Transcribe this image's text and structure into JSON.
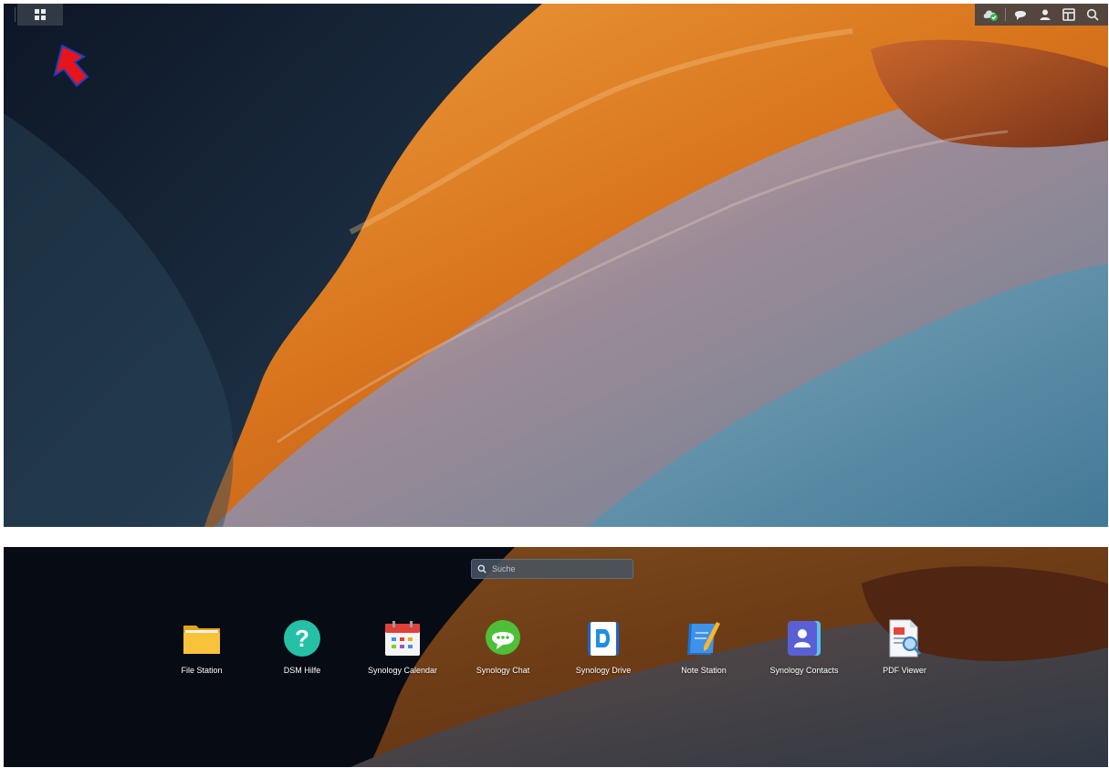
{
  "desktop": {
    "taskbar": {
      "main_menu_icon": "grid-icon",
      "tray_icons": [
        "cloud-sync-status-icon",
        "chat-icon",
        "user-icon",
        "widgets-icon",
        "search-icon"
      ]
    },
    "annotation": {
      "icon": "red-arrow",
      "color": "#e8141b"
    }
  },
  "launcher": {
    "search": {
      "placeholder": "Suche",
      "value": ""
    },
    "apps": [
      {
        "label": "File Station",
        "icon": "folder-icon"
      },
      {
        "label": "DSM Hilfe",
        "icon": "help-icon"
      },
      {
        "label": "Synology Calendar",
        "icon": "calendar-icon"
      },
      {
        "label": "Synology Chat",
        "icon": "chat-bubble-icon"
      },
      {
        "label": "Synology Drive",
        "icon": "drive-icon"
      },
      {
        "label": "Note Station",
        "icon": "note-icon"
      },
      {
        "label": "Synology Contacts",
        "icon": "contacts-icon"
      },
      {
        "label": "PDF Viewer",
        "icon": "pdf-viewer-icon"
      }
    ]
  },
  "colors": {
    "accent": "#2a9bd6",
    "tray_bg": "#3c3e44"
  }
}
